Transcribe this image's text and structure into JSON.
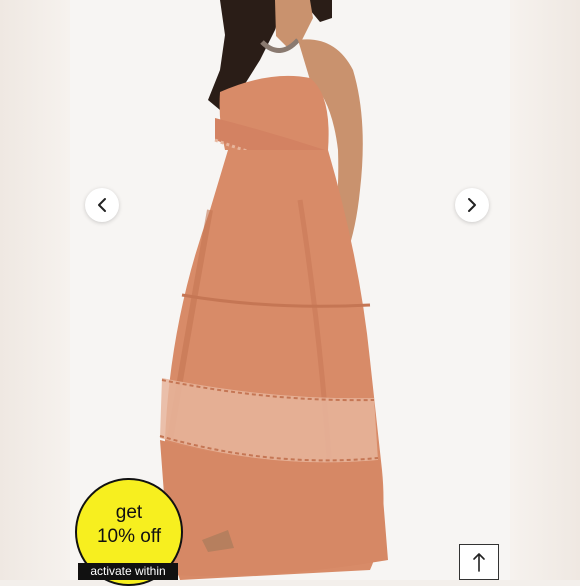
{
  "gallery": {
    "image_alt": "Model wearing a terracotta strapless tiered maxi dress with crochet lace trim",
    "prev_icon": "chevron-left-icon",
    "next_icon": "chevron-right-icon"
  },
  "promo": {
    "line1": "get",
    "line2": "10% off",
    "cta": "activate within",
    "color": "#f7ef1f"
  },
  "scroll_top": {
    "icon": "arrow-up-icon"
  },
  "colors": {
    "dress": "#d88b68",
    "dress_shadow": "#c57654",
    "lace": "#e7b59c",
    "skin": "#c9926e",
    "hair": "#2a1d17"
  }
}
